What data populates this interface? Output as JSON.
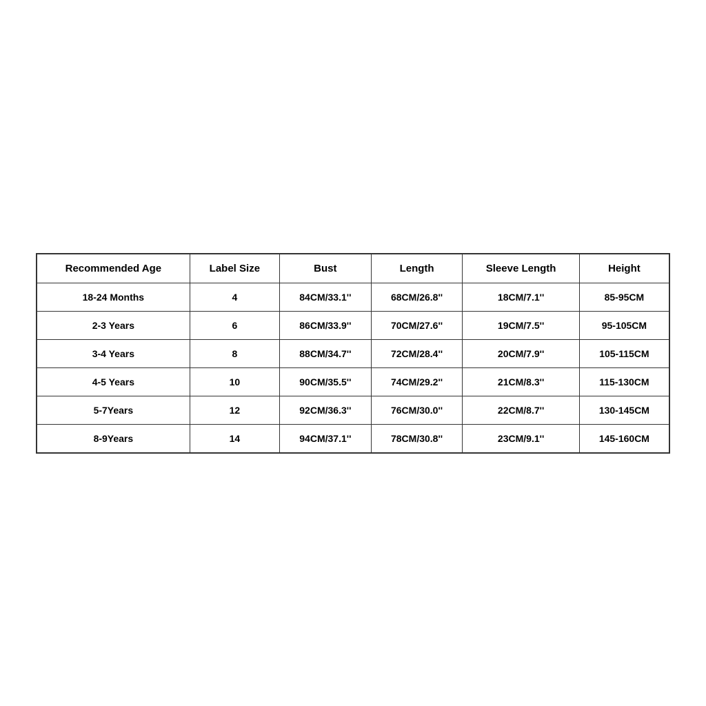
{
  "table": {
    "headers": [
      "Recommended Age",
      "Label Size",
      "Bust",
      "Length",
      "Sleeve Length",
      "Height"
    ],
    "rows": [
      {
        "age": "18-24 Months",
        "label_size": "4",
        "bust": "84CM/33.1''",
        "length": "68CM/26.8''",
        "sleeve_length": "18CM/7.1''",
        "height": "85-95CM"
      },
      {
        "age": "2-3 Years",
        "label_size": "6",
        "bust": "86CM/33.9''",
        "length": "70CM/27.6''",
        "sleeve_length": "19CM/7.5''",
        "height": "95-105CM"
      },
      {
        "age": "3-4 Years",
        "label_size": "8",
        "bust": "88CM/34.7''",
        "length": "72CM/28.4''",
        "sleeve_length": "20CM/7.9''",
        "height": "105-115CM"
      },
      {
        "age": "4-5 Years",
        "label_size": "10",
        "bust": "90CM/35.5''",
        "length": "74CM/29.2''",
        "sleeve_length": "21CM/8.3''",
        "height": "115-130CM"
      },
      {
        "age": "5-7Years",
        "label_size": "12",
        "bust": "92CM/36.3''",
        "length": "76CM/30.0''",
        "sleeve_length": "22CM/8.7''",
        "height": "130-145CM"
      },
      {
        "age": "8-9Years",
        "label_size": "14",
        "bust": "94CM/37.1''",
        "length": "78CM/30.8''",
        "sleeve_length": "23CM/9.1''",
        "height": "145-160CM"
      }
    ]
  }
}
